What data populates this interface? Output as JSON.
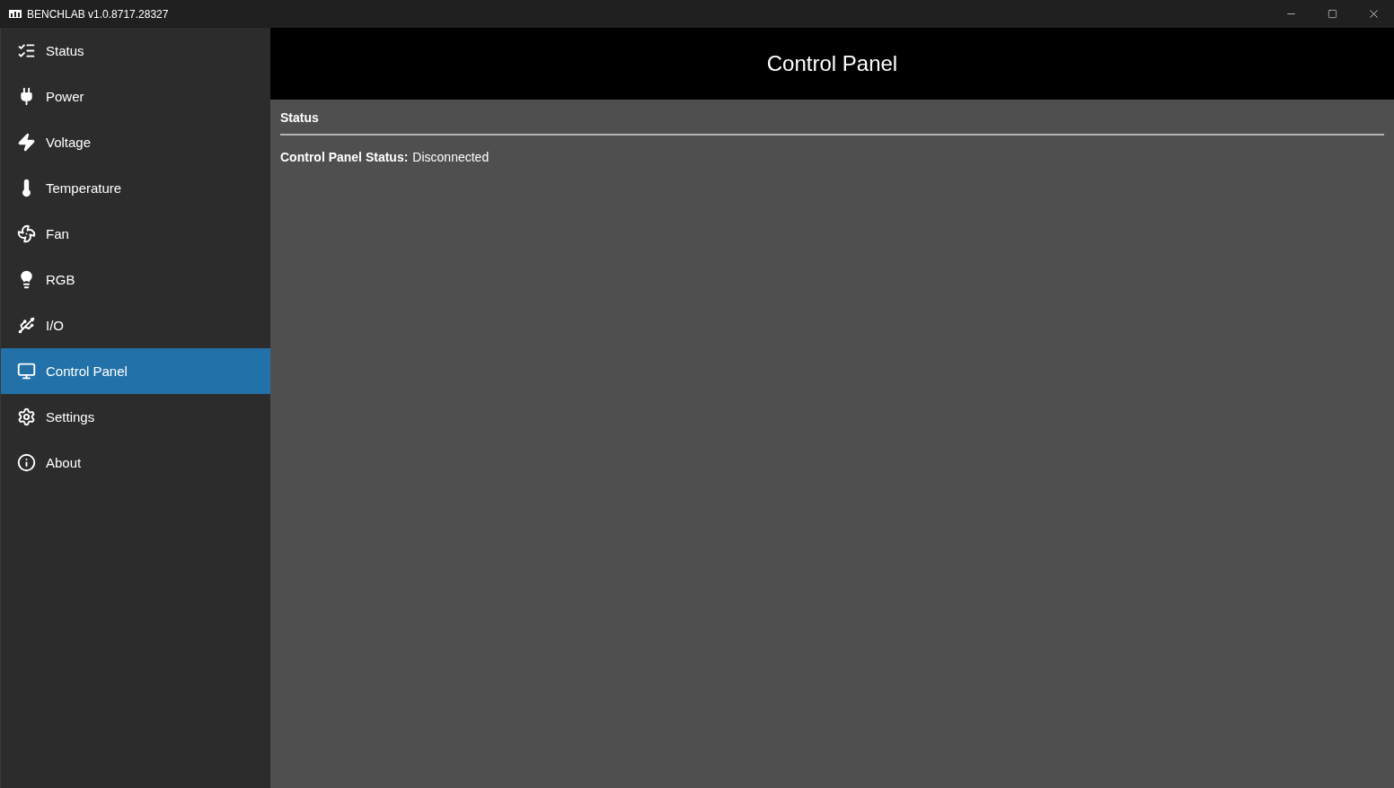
{
  "window": {
    "title": "BENCHLAB v1.0.8717.28327"
  },
  "sidebar": {
    "items": [
      {
        "kind": "status",
        "label": "Status",
        "selected": false
      },
      {
        "kind": "power",
        "label": "Power",
        "selected": false
      },
      {
        "kind": "voltage",
        "label": "Voltage",
        "selected": false
      },
      {
        "kind": "temperature",
        "label": "Temperature",
        "selected": false
      },
      {
        "kind": "fan",
        "label": "Fan",
        "selected": false
      },
      {
        "kind": "rgb",
        "label": "RGB",
        "selected": false
      },
      {
        "kind": "io",
        "label": "I/O",
        "selected": false
      },
      {
        "kind": "control",
        "label": "Control Panel",
        "selected": true
      },
      {
        "kind": "settings",
        "label": "Settings",
        "selected": false
      },
      {
        "kind": "about",
        "label": "About",
        "selected": false
      }
    ]
  },
  "header": {
    "title": "Control Panel"
  },
  "section": {
    "title": "Status",
    "fields": [
      {
        "label": "Control Panel Status:",
        "value": "Disconnected"
      }
    ]
  }
}
